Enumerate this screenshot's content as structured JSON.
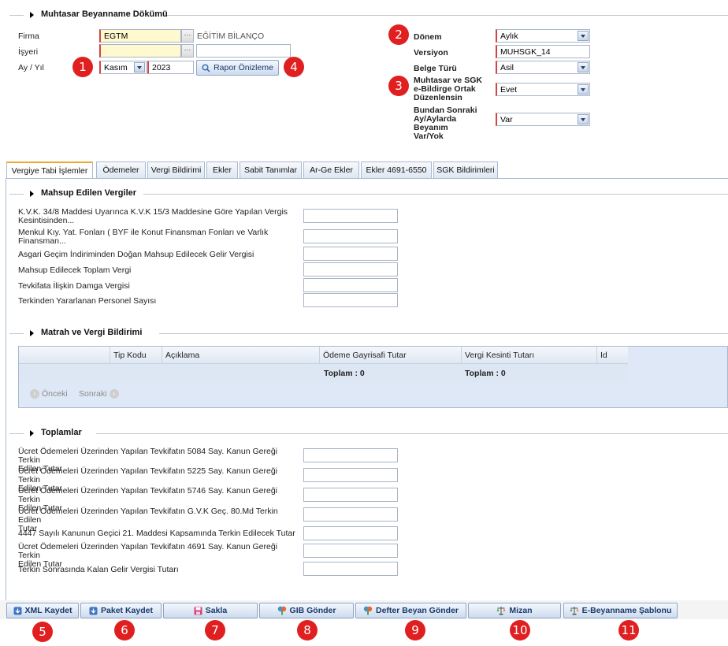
{
  "section_top": {
    "title": "Muhtasar Beyanname Dökümü"
  },
  "left_form": {
    "firma_label": "Firma",
    "firma_value": "EGTM",
    "firma_desc": "EĞİTİM BİLANÇO",
    "isyeri_label": "İşyeri",
    "isyeri_value": "",
    "ay_yil_label": "Ay / Yıl",
    "month_value": "Kasım",
    "year_value": "2023",
    "preview_button": "Rapor Önizleme"
  },
  "right_form": {
    "donem_label": "Dönem",
    "donem_value": "Aylık",
    "versiyon_label": "Versiyon",
    "versiyon_value": "MUHSGK_14",
    "belge_label": "Belge Türü",
    "belge_value": "Asil",
    "muhtasar_label_1": "Muhtasar ve SGK",
    "muhtasar_label_2": "e-Bildirge Ortak",
    "muhtasar_label_3": "Düzenlensin",
    "muhtasar_value": "Evet",
    "bundan_label_1": "Bundan Sonraki",
    "bundan_label_2": "Ay/Aylarda Beyanım",
    "bundan_label_3": "Var/Yok",
    "bundan_value": "Var"
  },
  "badges": [
    "1",
    "2",
    "3",
    "4",
    "5",
    "6",
    "7",
    "8",
    "9",
    "10",
    "11"
  ],
  "tabs": [
    {
      "label": "Vergiye Tabi İşlemler"
    },
    {
      "label": "Ödemeler"
    },
    {
      "label": "Vergi Bildirimi"
    },
    {
      "label": "Ekler"
    },
    {
      "label": "Sabit Tanımlar"
    },
    {
      "label": "Ar-Ge Ekler"
    },
    {
      "label": "Ekler 4691-6550"
    },
    {
      "label": "SGK Bildirimleri"
    }
  ],
  "mahsup": {
    "title": "Mahsup Edilen Vergiler",
    "rows": [
      {
        "l1": "K.V.K. 34/8 Maddesi Uyarınca K.V.K 15/3 Maddesine Göre Yapılan Vergis",
        "l2": "Kesintisinden..."
      },
      {
        "l1": "Menkul Kıy. Yat. Fonları ( BYF ile Konut Finansman Fonları ve Varlık",
        "l2": "Finansman..."
      },
      {
        "l1": "Asgari Geçim İndiriminden Doğan Mahsup Edilecek Gelir Vergisi",
        "l2": ""
      },
      {
        "l1": "Mahsup Edilecek Toplam Vergi",
        "l2": ""
      },
      {
        "l1": "Tevkifata İlişkin Damga Vergisi",
        "l2": ""
      },
      {
        "l1": "Terkinden Yararlanan Personel Sayısı",
        "l2": ""
      }
    ]
  },
  "matrah": {
    "title": "Matrah ve Vergi Bildirimi",
    "columns": [
      "Tip Kodu",
      "Açıklama",
      "Ödeme Gayrisafi Tutar",
      "Vergi Kesinti Tutarı",
      "Id"
    ],
    "total_1": "Toplam : 0",
    "total_2": "Toplam : 0",
    "prev": "Önceki",
    "next": "Sonraki"
  },
  "toplamlar": {
    "title": "Toplamlar",
    "rows": [
      {
        "l1": "Ücret Ödemeleri Üzerinden Yapılan Tevkifatın 5084 Say. Kanun Gereği Terkin",
        "l2": "Edilen Tutar"
      },
      {
        "l1": "Ücret Ödemeleri Üzerinden Yapılan Tevkifatın 5225 Say. Kanun Gereği Terkin",
        "l2": "Edilen Tutar"
      },
      {
        "l1": "Ücret Ödemeleri Üzerinden Yapılan Tevkifatın 5746 Say. Kanun Gereği Terkin",
        "l2": "Edilen Tutar"
      },
      {
        "l1": "Ücret Ödemeleri Üzerinden Yapılan Tevkifatın G.V.K Geç. 80.Md Terkin Edilen",
        "l2": "Tutar"
      },
      {
        "l1": "4447 Sayılı Kanunun Geçici 21. Maddesi Kapsamında Terkin Edilecek Tutar",
        "l2": ""
      },
      {
        "l1": "Ücret Ödemeleri Üzerinden Yapılan Tevkifatın 4691 Say. Kanun Gereği Terkin",
        "l2": "Edilen Tutar"
      },
      {
        "l1": "Terkin Sonrasında Kalan Gelir Vergisi Tutarı",
        "l2": ""
      }
    ]
  },
  "bottom_buttons": [
    {
      "label": "XML Kaydet",
      "icon": "download-icon"
    },
    {
      "label": "Paket Kaydet",
      "icon": "download-icon"
    },
    {
      "label": "Sakla",
      "icon": "save-icon"
    },
    {
      "label": "GIB Gönder",
      "icon": "send-icon"
    },
    {
      "label": "Defter Beyan Gönder",
      "icon": "send-icon"
    },
    {
      "label": "Mizan",
      "icon": "scale-icon"
    },
    {
      "label": "E-Beyanname Şablonu",
      "icon": "scale-icon"
    }
  ],
  "colors": {
    "badge": "#e02020",
    "active_tab_top": "#f0a830",
    "required_border": "#d04444",
    "required_fill": "#fff9cf"
  }
}
